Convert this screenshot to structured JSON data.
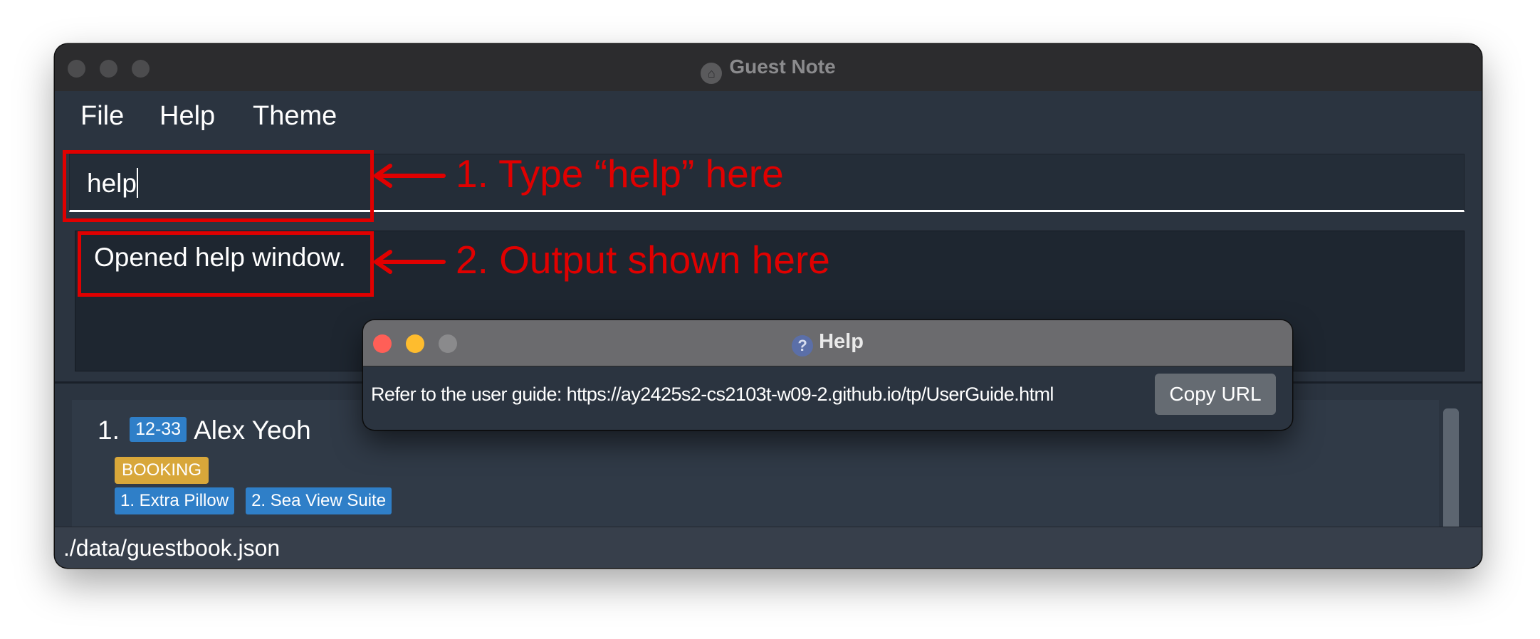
{
  "window": {
    "title": "Guest Note"
  },
  "menu": {
    "file": "File",
    "help": "Help",
    "theme": "Theme"
  },
  "command_box": {
    "value": "help"
  },
  "result_box": {
    "text": "Opened help window."
  },
  "guest_list": {
    "items": [
      {
        "index": "1.",
        "room": "12-33",
        "name": "Alex Yeoh",
        "status": "BOOKING",
        "requests": [
          "1. Extra Pillow",
          "2. Sea View Suite"
        ]
      }
    ]
  },
  "status_bar": {
    "path": "./data/guestbook.json"
  },
  "help_window": {
    "title": "Help",
    "message": "Refer to the user guide: https://ay2425s2-cs2103t-w09-2.github.io/tp/UserGuide.html",
    "copy_button": "Copy URL"
  },
  "annotations": {
    "step1": "1. Type “help” here",
    "step2": "2. Output shown here"
  },
  "colors": {
    "annotation_red": "#e00000",
    "window_bg": "#2b3440",
    "room_tag": "#2f7fc8",
    "status_tag": "#d8a73a",
    "close_red": "#ff5f57",
    "minimize_yellow": "#febc2e"
  }
}
